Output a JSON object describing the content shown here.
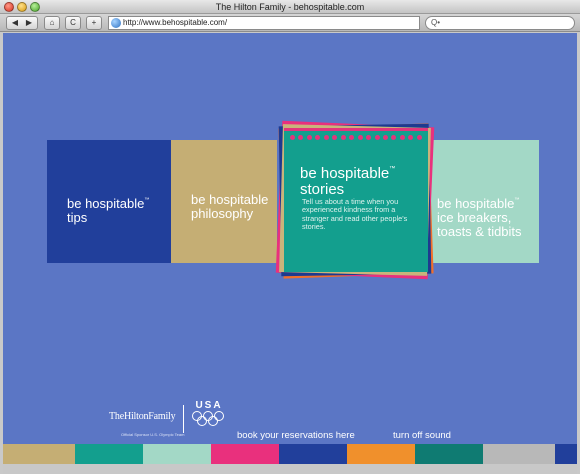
{
  "window": {
    "title": "The Hilton Family - behospitable.com"
  },
  "toolbar": {
    "back_glyph": "◀",
    "forward_glyph": "▶",
    "home_glyph": "⌂",
    "reload_glyph": "C",
    "add_glyph": "+",
    "url": "http://www.behospitable.com/",
    "search_placeholder": "Q•"
  },
  "panels": {
    "tips": {
      "line1": "be hospitable",
      "tm": "™",
      "line2": "tips"
    },
    "philosophy": {
      "line1": "be hospitable",
      "line2": "philosophy"
    },
    "icebreakers": {
      "line1": "be hospitable",
      "tm": "™",
      "line2": "ice breakers,",
      "line3": "toasts & tidbits"
    }
  },
  "featured": {
    "line1": "be hospitable",
    "tm": "™",
    "line2": "stories",
    "description": "Tell us about a time when you experienced kindness from a stranger and read other people's stories."
  },
  "footer": {
    "brand": "TheHiltonFamily",
    "brand_sub": "Official Sponsor U.S. Olympic Team",
    "usa_label": "USA",
    "book_link": "book your reservations here",
    "sound_link": "turn off sound"
  },
  "colors": {
    "background": "#5b76c5",
    "stripe": [
      "#c5ae74",
      "#139f8e",
      "#a3d8c6",
      "#e9307d",
      "#213f9b",
      "#f0902c",
      "#0f7b72",
      "#b8b8b8",
      "#213f9b"
    ]
  }
}
